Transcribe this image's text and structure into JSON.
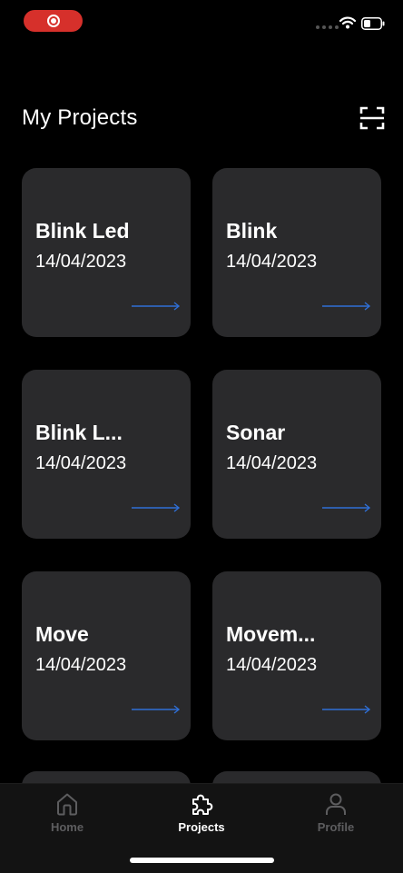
{
  "header": {
    "title": "My Projects",
    "scan_icon": "scan-frame-icon"
  },
  "projects": [
    {
      "name": "Blink Led",
      "date": "14/04/2023"
    },
    {
      "name": "Blink",
      "date": "14/04/2023"
    },
    {
      "name": "Blink L...",
      "date": "14/04/2023"
    },
    {
      "name": "Sonar",
      "date": "14/04/2023"
    },
    {
      "name": "Move",
      "date": "14/04/2023"
    },
    {
      "name": "Movem...",
      "date": "14/04/2023"
    }
  ],
  "tabs": [
    {
      "label": "Home",
      "icon": "home-icon",
      "active": false
    },
    {
      "label": "Projects",
      "icon": "puzzle-icon",
      "active": true
    },
    {
      "label": "Profile",
      "icon": "person-icon",
      "active": false
    }
  ],
  "colors": {
    "background": "#000000",
    "card": "#2a2a2c",
    "accent_arrow": "#2f6fd6",
    "record": "#d6302b",
    "tab_inactive": "#5d5d5f"
  }
}
